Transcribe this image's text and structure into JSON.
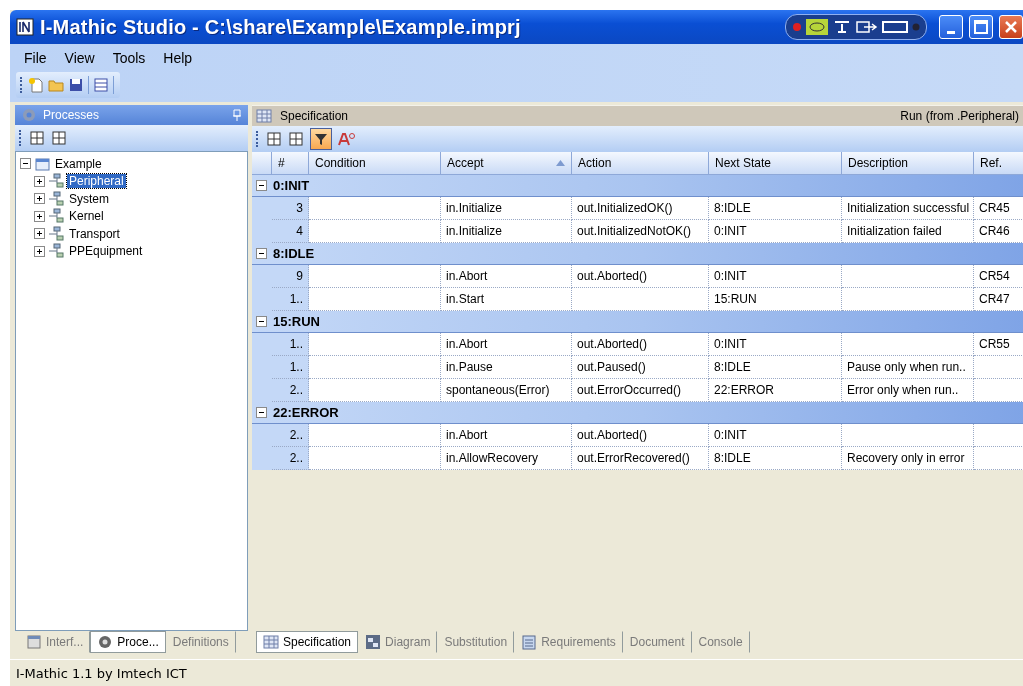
{
  "window": {
    "title": "I-Mathic Studio - C:\\share\\Example\\Example.imprj"
  },
  "menu": [
    "File",
    "View",
    "Tools",
    "Help"
  ],
  "processes_panel": {
    "title": "Processes",
    "tree": [
      {
        "label": "Example",
        "expanded": true,
        "selected": false,
        "children": [
          {
            "label": "Peripheral",
            "expanded": false,
            "selected": true
          },
          {
            "label": "System",
            "expanded": false,
            "selected": false
          },
          {
            "label": "Kernel",
            "expanded": false,
            "selected": false
          },
          {
            "label": "Transport",
            "expanded": false,
            "selected": false
          },
          {
            "label": "PPEquipment",
            "expanded": false,
            "selected": false
          }
        ]
      }
    ]
  },
  "left_tabs": [
    {
      "label": "Interf...",
      "selected": false,
      "kind": "interface"
    },
    {
      "label": "Proce...",
      "selected": true,
      "kind": "process"
    },
    {
      "label": "Definitions",
      "selected": false,
      "kind": "plain"
    }
  ],
  "specification": {
    "title": "Specification",
    "context": "Run (from .Peripheral)",
    "filter_active": true,
    "columns": [
      {
        "label": "#",
        "sorted": false
      },
      {
        "label": "Condition",
        "sorted": false
      },
      {
        "label": "Accept",
        "sorted": true
      },
      {
        "label": "Action",
        "sorted": false
      },
      {
        "label": "Next State",
        "sorted": false
      },
      {
        "label": "Description",
        "sorted": false
      },
      {
        "label": "Ref.",
        "sorted": false
      }
    ],
    "groups": [
      {
        "state": "0:INIT",
        "expanded": true,
        "rows": [
          [
            "3",
            "",
            "in.Initialize",
            "out.InitializedOK()",
            "8:IDLE",
            "Initialization successful",
            "CR45"
          ],
          [
            "4",
            "",
            "in.Initialize",
            "out.InitializedNotOK()",
            "0:INIT",
            "Initialization failed",
            "CR46"
          ]
        ]
      },
      {
        "state": "8:IDLE",
        "expanded": true,
        "rows": [
          [
            "9",
            "",
            "in.Abort",
            "out.Aborted()",
            "0:INIT",
            "",
            "CR54"
          ],
          [
            "1..",
            "",
            "in.Start",
            "",
            "15:RUN",
            "",
            "CR47"
          ]
        ]
      },
      {
        "state": "15:RUN",
        "expanded": true,
        "rows": [
          [
            "1..",
            "",
            "in.Abort",
            "out.Aborted()",
            "0:INIT",
            "",
            "CR55"
          ],
          [
            "1..",
            "",
            "in.Pause",
            "out.Paused()",
            "8:IDLE",
            "Pause only when run..",
            ""
          ],
          [
            "2..",
            "",
            "spontaneous(Error)",
            "out.ErrorOccurred()",
            "22:ERROR",
            "Error only when run..",
            ""
          ]
        ]
      },
      {
        "state": "22:ERROR",
        "expanded": true,
        "rows": [
          [
            "2..",
            "",
            "in.Abort",
            "out.Aborted()",
            "0:INIT",
            "",
            ""
          ],
          [
            "2..",
            "",
            "in.AllowRecovery",
            "out.ErrorRecovered()",
            "8:IDLE",
            "Recovery only in error",
            ""
          ]
        ]
      }
    ]
  },
  "bottom_tabs": [
    {
      "label": "Specification",
      "selected": true,
      "kind": "table"
    },
    {
      "label": "Diagram",
      "selected": false,
      "kind": "diagram"
    },
    {
      "label": "Substitution",
      "selected": false,
      "kind": "plain"
    },
    {
      "label": "Requirements",
      "selected": false,
      "kind": "checklist"
    },
    {
      "label": "Document",
      "selected": false,
      "kind": "plain"
    },
    {
      "label": "Console",
      "selected": false,
      "kind": "plain"
    }
  ],
  "status_bar": "I-Mathic 1.1 by Imtech ICT"
}
